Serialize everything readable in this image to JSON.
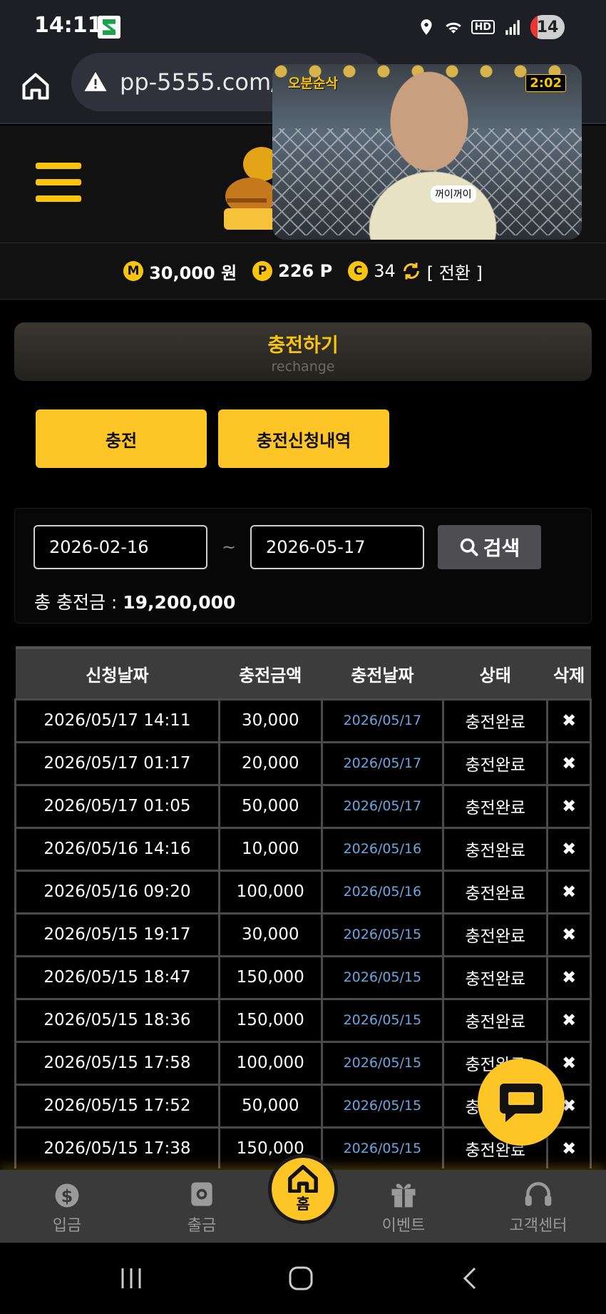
{
  "status_bar": {
    "time": "14:11",
    "hd": "HD",
    "battery": "14"
  },
  "browser": {
    "url": "pp-5555.com/c"
  },
  "pip": {
    "logo": "오분순삭",
    "time": "2:02",
    "caption": "꺼이꺼이"
  },
  "points": {
    "money": {
      "badge": "M",
      "value": "30,000 원"
    },
    "point": {
      "badge": "P",
      "value": "226 P"
    },
    "coupon": {
      "badge": "C",
      "value": "34"
    },
    "switch_label": "[ 전환 ]"
  },
  "title": {
    "main": "충전하기",
    "sub": "rechange"
  },
  "tabs": [
    "충전",
    "충전신청내역"
  ],
  "search": {
    "from": "2026-02-16",
    "to": "2026-05-17",
    "tilde": "~",
    "button": "검색"
  },
  "total": {
    "label": "총 충전금 : ",
    "value": "19,200,000"
  },
  "table": {
    "headers": [
      "신청날짜",
      "충전금액",
      "충전날짜",
      "상태",
      "삭제"
    ],
    "rows": [
      [
        "2026/05/17 14:11",
        "30,000",
        "2026/05/17",
        "충전완료",
        "✖"
      ],
      [
        "2026/05/17 01:17",
        "20,000",
        "2026/05/17",
        "충전완료",
        "✖"
      ],
      [
        "2026/05/17 01:05",
        "50,000",
        "2026/05/17",
        "충전완료",
        "✖"
      ],
      [
        "2026/05/16 14:16",
        "10,000",
        "2026/05/16",
        "충전완료",
        "✖"
      ],
      [
        "2026/05/16 09:20",
        "100,000",
        "2026/05/16",
        "충전완료",
        "✖"
      ],
      [
        "2026/05/15 19:17",
        "30,000",
        "2026/05/15",
        "충전완료",
        "✖"
      ],
      [
        "2026/05/15 18:47",
        "150,000",
        "2026/05/15",
        "충전완료",
        "✖"
      ],
      [
        "2026/05/15 18:36",
        "150,000",
        "2026/05/15",
        "충전완료",
        "✖"
      ],
      [
        "2026/05/15 17:58",
        "100,000",
        "2026/05/15",
        "충전완료",
        "✖"
      ],
      [
        "2026/05/15 17:52",
        "50,000",
        "2026/05/15",
        "충전완료",
        "✖"
      ],
      [
        "2026/05/15 17:38",
        "150,000",
        "2026/05/15",
        "충전완료",
        "✖"
      ]
    ]
  },
  "bottom_nav": {
    "deposit": "입금",
    "withdraw": "출금",
    "home": "홈",
    "event": "이벤트",
    "support": "고객센터"
  },
  "colors": {
    "accent": "#fdc526",
    "link_date": "#6aa7e0",
    "background": "#000000"
  }
}
